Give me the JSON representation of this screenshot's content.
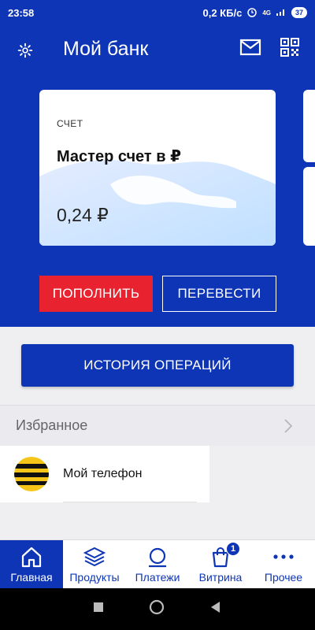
{
  "status_bar": {
    "time": "23:58",
    "network_speed": "0,2 КБ/с",
    "network_type": "4G",
    "battery": "37"
  },
  "header": {
    "title": "Мой банк",
    "settings_icon": "gear-icon",
    "mail_icon": "mail-icon",
    "qr_icon": "qr-code-icon"
  },
  "card": {
    "label": "СЧЕТ",
    "name": "Мастер счет в ₽",
    "balance": "0,24 ₽"
  },
  "actions": {
    "topup_label": "ПОПОЛНИТЬ",
    "transfer_label": "ПЕРЕВЕСТИ",
    "history_label": "ИСТОРИЯ ОПЕРАЦИЙ"
  },
  "favorites": {
    "title": "Избранное",
    "items": [
      {
        "name": "Мой телефон"
      }
    ]
  },
  "bottom_nav": {
    "items": [
      {
        "label": "Главная",
        "icon": "home-icon",
        "active": true
      },
      {
        "label": "Продукты",
        "icon": "layers-icon"
      },
      {
        "label": "Платежи",
        "icon": "payments-icon"
      },
      {
        "label": "Витрина",
        "icon": "shopping-bag-icon",
        "badge": "1"
      },
      {
        "label": "Прочее",
        "icon": "more-icon"
      }
    ]
  },
  "colors": {
    "brand_blue": "#0e35b5",
    "accent_red": "#e8222e"
  }
}
